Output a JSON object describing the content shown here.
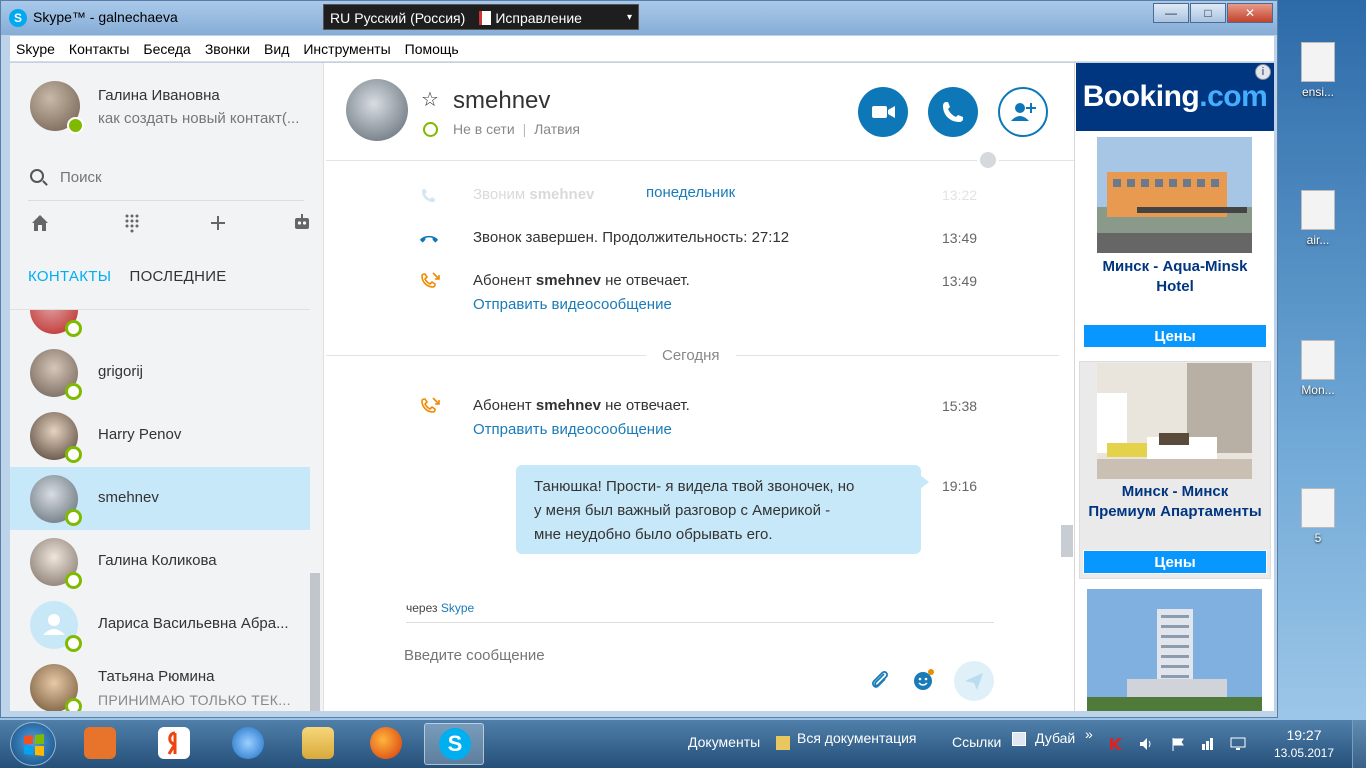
{
  "window": {
    "title": "Skype™ - galnechaeva",
    "app_icon": "S"
  },
  "language_bar": {
    "code": "RU",
    "language": "Русский (Россия)",
    "mode": "Исправление"
  },
  "window_buttons": {
    "minimize": "—",
    "maximize": "□",
    "close": "✕"
  },
  "menu": [
    "Skype",
    "Контакты",
    "Беседа",
    "Звонки",
    "Вид",
    "Инструменты",
    "Помощь"
  ],
  "profile": {
    "name": "Галина Ивановна",
    "mood": "как создать новый контакт(..."
  },
  "search": {
    "placeholder": "Поиск"
  },
  "toolbar": {
    "home": "home-icon",
    "dialpad": "dialpad-icon",
    "add": "plus-icon",
    "bot": "bot-icon"
  },
  "tabs": {
    "contacts": "КОНТАКТЫ",
    "recent": "ПОСЛЕДНИЕ"
  },
  "contacts": [
    {
      "name": "grigorij",
      "mood": ""
    },
    {
      "name": "Harry Penov",
      "mood": ""
    },
    {
      "name": "smehnev",
      "mood": ""
    },
    {
      "name": "Галина Коликова",
      "mood": ""
    },
    {
      "name": "Лариса Васильевна Абра...",
      "mood": ""
    },
    {
      "name": "Татьяна Рюмина",
      "mood": "ПРИНИМАЮ ТОЛЬКО ТЕК..."
    }
  ],
  "chat": {
    "peer_name": "smehnev",
    "peer_status": "Не в сети",
    "peer_location": "Латвия",
    "status_separator": "|",
    "messages": [
      {
        "text_pre": "Звоним ",
        "bold": "smehnev",
        "text_post": "",
        "day": "понедельник",
        "time": "13:22"
      },
      {
        "text": "Звонок завершен. Продолжительность: 27:12",
        "time": "13:49"
      },
      {
        "text_pre": "Абонент ",
        "bold": "smehnev",
        "text_post": " не отвечает.",
        "link": "Отправить видеосообщение",
        "time": "13:49"
      }
    ],
    "day_label": "Сегодня",
    "today": [
      {
        "text_pre": "Абонент ",
        "bold": "smehnev",
        "text_post": " не отвечает.",
        "link": "Отправить видеосообщение",
        "time": "15:38"
      }
    ],
    "bubble": {
      "lines": [
        "Танюшка! Прости- я видела твой  звоночек, но",
        "у меня  был важный разговор с  Америкой -",
        "мне неудобно было обрывать его."
      ],
      "time": "19:16"
    },
    "via_prefix": "через",
    "via_link": "Skype",
    "input_placeholder": "Введите сообщение"
  },
  "ad": {
    "logo_main": "Booking",
    "logo_dot": ".com",
    "info": "i",
    "hotels": [
      {
        "name_line1": "Минск - Aqua-Minsk",
        "name_line2": "Hotel",
        "button": "Цены"
      },
      {
        "name_line1": "Минск - Минск",
        "name_line2": "Премиум Апартаменты",
        "button": "Цены"
      }
    ]
  },
  "desktop_icons": [
    "ensi...",
    "air...",
    "Mon...",
    "5"
  ],
  "taskbar": {
    "documents": "Документы",
    "all_docs": "Вся документация",
    "links": "Ссылки",
    "dubai": "Дубай",
    "more": "»",
    "time": "19:27",
    "date": "13.05.2017"
  },
  "colors": {
    "accent": "#00aff0",
    "call_button": "#0d77b7",
    "online": "#7fba00",
    "bubble": "#c7e8f8",
    "booking": "#003580",
    "price_button": "#0896ff"
  }
}
